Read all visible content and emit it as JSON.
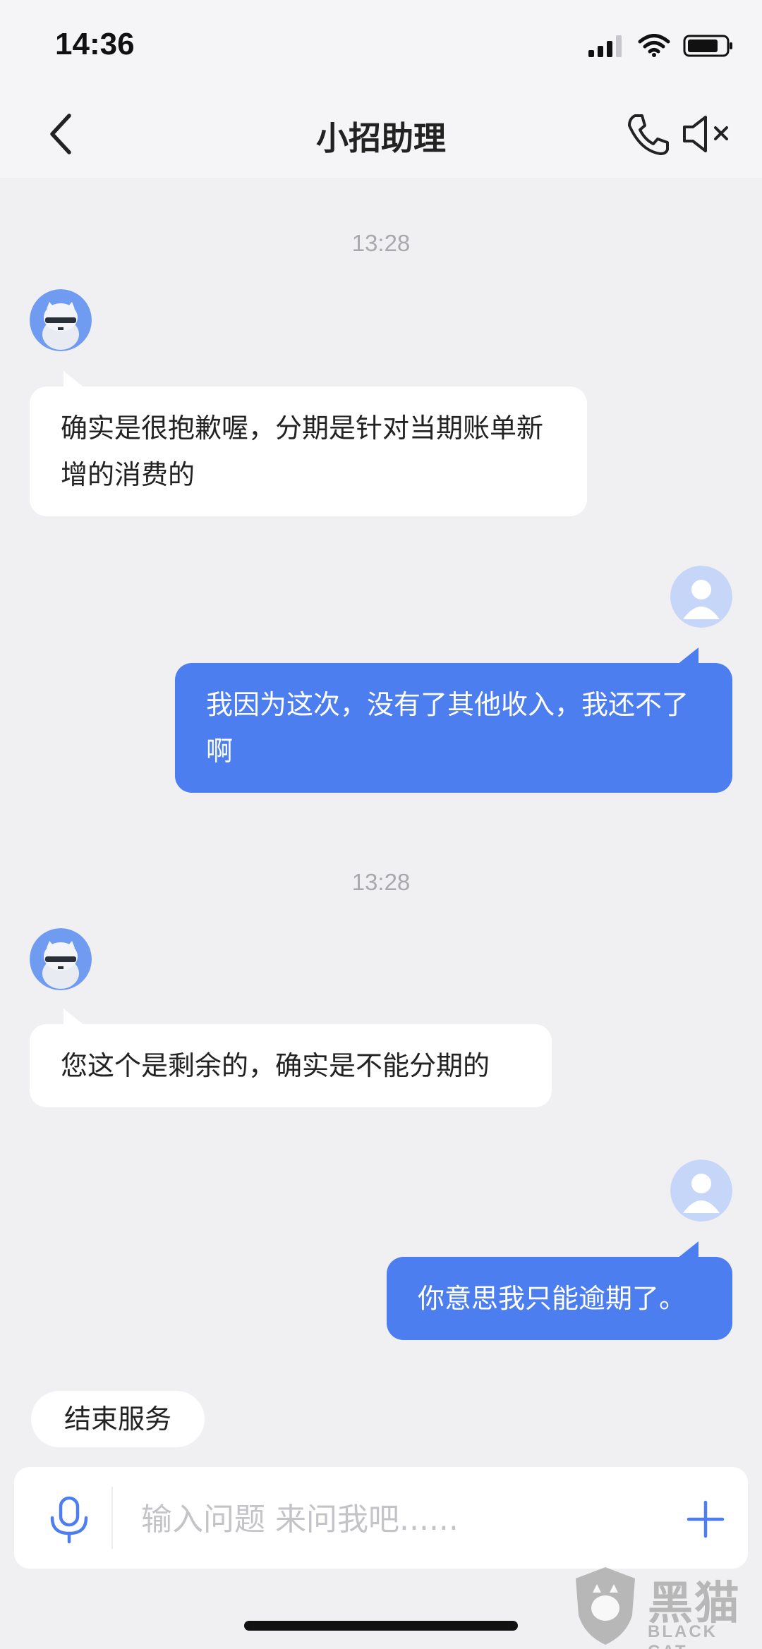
{
  "status_bar": {
    "time": "14:36"
  },
  "header": {
    "title": "小招助理"
  },
  "messages": [
    {
      "type": "timestamp",
      "text": "13:28"
    },
    {
      "sender": "assistant",
      "text": "确实是很抱歉喔，分期是针对当期账单新增的消费的"
    },
    {
      "sender": "user",
      "text": "我因为这次，没有了其他收入，我还不了啊"
    },
    {
      "type": "timestamp",
      "text": "13:28"
    },
    {
      "sender": "assistant",
      "text": "您这个是剩余的，确实是不能分期的"
    },
    {
      "sender": "user",
      "text": "你意思我只能逾期了。"
    }
  ],
  "quick_actions": {
    "end_service": "结束服务"
  },
  "input": {
    "placeholder": "输入问题 来问我吧......",
    "value": ""
  },
  "watermark": {
    "cn": "黑猫",
    "en": "BLACK CAT"
  },
  "icons": {
    "back": "chevron-left-icon",
    "phone": "phone-icon",
    "mute": "speaker-mute-icon",
    "mic": "microphone-icon",
    "plus": "plus-icon"
  },
  "colors": {
    "accent": "#4d7ef0",
    "background": "#f0f0f2",
    "bubble_left": "#ffffff"
  }
}
